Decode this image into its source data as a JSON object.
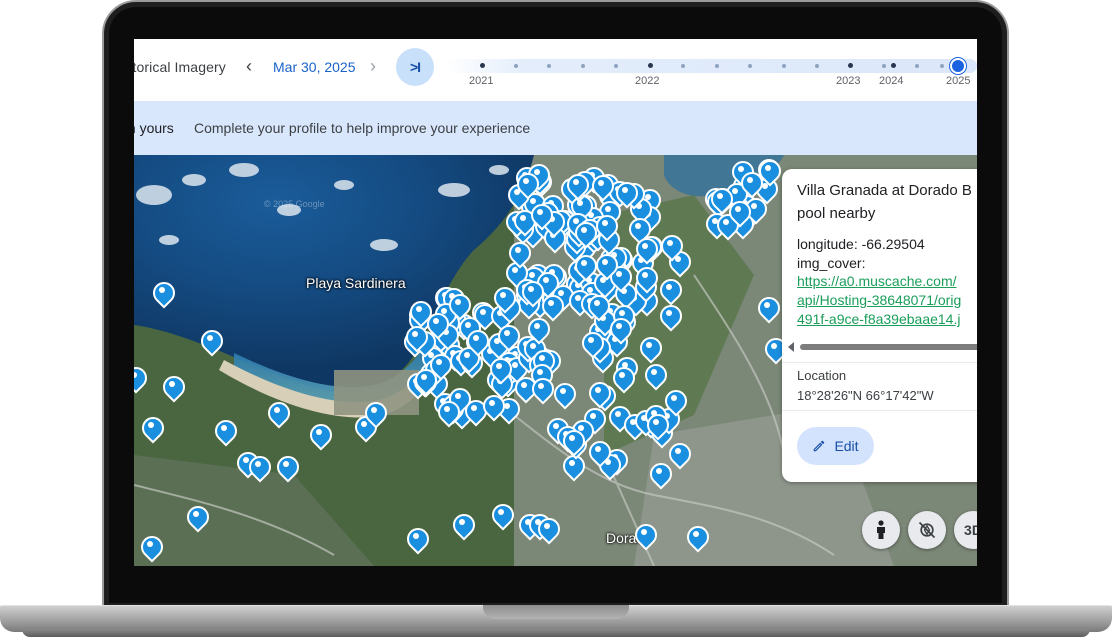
{
  "topbar": {
    "title": "Historical Imagery",
    "prev_icon": "chevron-left-icon",
    "date": "Mar 30, 2025",
    "next_icon": "chevron-right-icon",
    "latest_label": ">I",
    "years": [
      "2021",
      "2022",
      "2023",
      "2024",
      "2025"
    ],
    "selected_year": "2025"
  },
  "banner": {
    "lead": "th yours",
    "message": "Complete your profile to help improve your experience"
  },
  "map": {
    "labels": {
      "beach": "Playa Sardinera",
      "town": "Dorado",
      "watermark": "© 2025 Google"
    },
    "pin_color": "#1a8fe0"
  },
  "card": {
    "name_line1": "Villa Granada at Dorado B",
    "name_line2": "pool nearby",
    "longitude": "longitude: -66.29504",
    "img_cover_label": "img_cover:",
    "img_cover_link1": "https://a0.muscache.com/",
    "img_cover_link2": "api/Hosting-38648071/orig",
    "img_cover_link3": "491f-a9ce-f8a39ebaae14.j",
    "location_label": "Location",
    "location_value": "18°28'26\"N 66°17'42\"W",
    "edit_label": "Edit"
  },
  "controls": {
    "pegman_icon": "pegman-icon",
    "compass_icon": "rotate-compass-icon",
    "view_3d_label": "3D"
  }
}
